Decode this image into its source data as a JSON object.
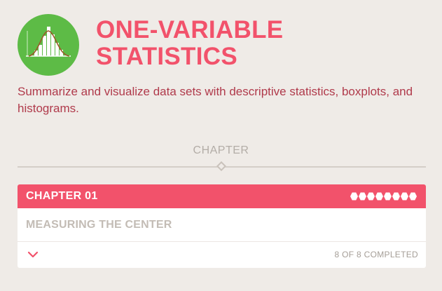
{
  "course": {
    "title": "ONE-VARIABLE STATISTICS",
    "description": "Summarize and visualize data sets with descriptive statistics, boxplots, and histograms.",
    "icon": "histogram-bell-curve-icon",
    "accent_color": "#f2526b",
    "icon_background": "#5dbb46"
  },
  "section": {
    "label": "CHAPTER"
  },
  "chapter": {
    "number_label": "CHAPTER 01",
    "lessons": [
      {
        "title": "MEASURING THE CENTER"
      }
    ],
    "completed": 8,
    "total": 8,
    "status_text": "8 OF 8 COMPLETED",
    "toggle_icon": "chevron-down-icon"
  }
}
